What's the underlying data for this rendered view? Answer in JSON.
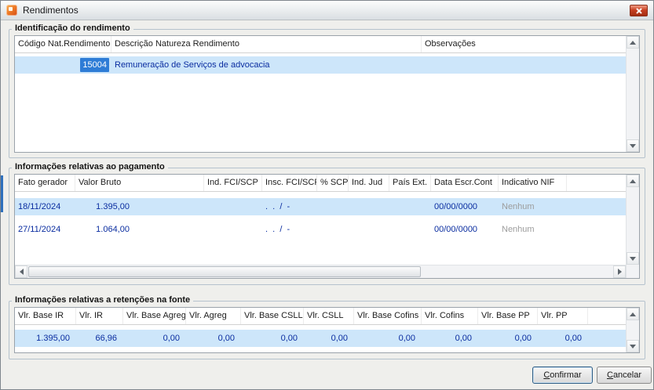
{
  "window": {
    "title": "Rendimentos"
  },
  "colors": {
    "row-selected": "#cde6fa",
    "cell-selected-bg": "#2e7cd6",
    "cell-selected-text": "#ffffff",
    "grid-text": "#0a2da0",
    "muted-text": "#9c9c9c",
    "close-red": "#c63f22"
  },
  "groups": {
    "identificacao": {
      "title": "Identificação do rendimento",
      "columns": [
        "Código Nat.Rendimento",
        "Descrição Natureza Rendimento",
        "Observações"
      ],
      "rows": [
        {
          "codigo": "15004",
          "descricao": "Remuneração de Serviços de advocacia",
          "observacoes": ""
        }
      ]
    },
    "pagamento": {
      "title": "Informações relativas ao pagamento",
      "columns": [
        "Fato gerador",
        "Valor Bruto",
        "Ind. FCI/SCP",
        "Insc. FCI/SCP",
        "% SCP",
        "Ind. Jud",
        "País Ext.",
        "Data Escr.Cont",
        "Indicativo NIF"
      ],
      "rows": [
        {
          "fato_gerador": "18/11/2024",
          "valor_bruto": "1.395,00",
          "ind_fci_scp": "",
          "insc_fci_scp": ".  .  /  -",
          "pct_scp": "",
          "ind_jud": "",
          "pais_ext": "",
          "data_escr_cont": "00/00/0000",
          "indicativo_nif": "Nenhum"
        },
        {
          "fato_gerador": "27/11/2024",
          "valor_bruto": "1.064,00",
          "ind_fci_scp": "",
          "insc_fci_scp": ".  .  /  -",
          "pct_scp": "",
          "ind_jud": "",
          "pais_ext": "",
          "data_escr_cont": "00/00/0000",
          "indicativo_nif": "Nenhum"
        }
      ]
    },
    "retencoes": {
      "title": "Informações relativas a retenções na fonte",
      "columns": [
        "Vlr. Base IR",
        "Vlr. IR",
        "Vlr. Base Agreg",
        "Vlr. Agreg",
        "Vlr. Base CSLL",
        "Vlr. CSLL",
        "Vlr. Base Cofins",
        "Vlr. Cofins",
        "Vlr. Base PP",
        "Vlr. PP"
      ],
      "rows": [
        {
          "values": [
            "1.395,00",
            "66,96",
            "0,00",
            "0,00",
            "0,00",
            "0,00",
            "0,00",
            "0,00",
            "0,00",
            "0,00"
          ]
        }
      ]
    }
  },
  "buttons": {
    "confirm": "Confirmar",
    "cancel": "Cancelar"
  }
}
